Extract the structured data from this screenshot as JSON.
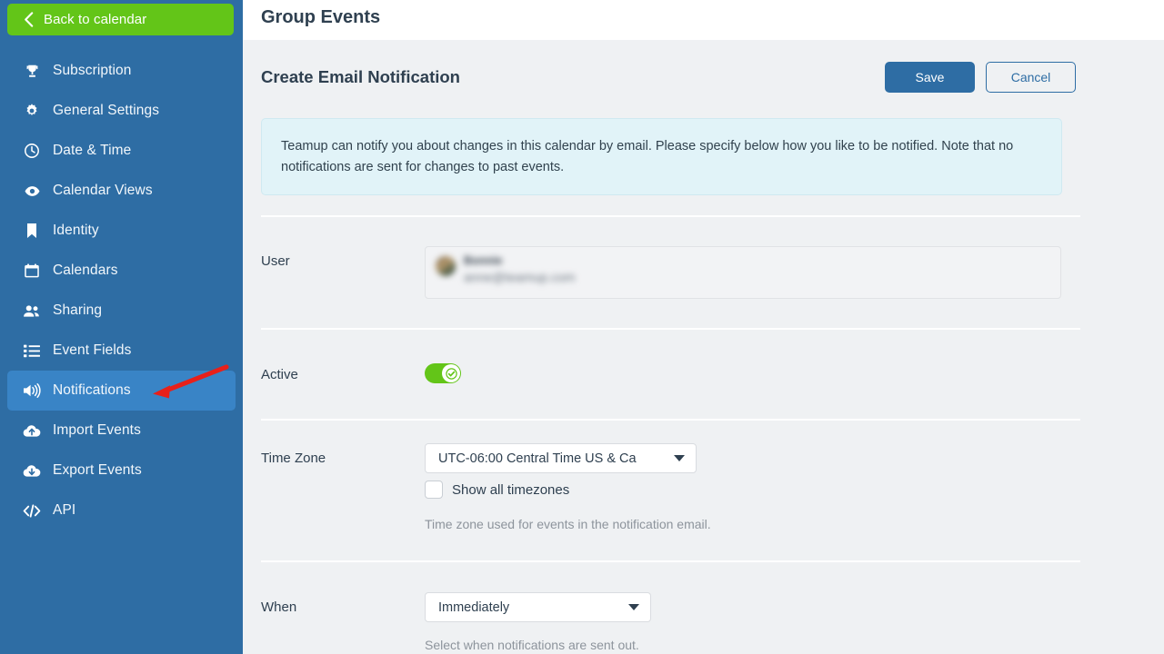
{
  "sidebar": {
    "back_button": {
      "label": "Back to calendar",
      "icon": "chevron-left-icon"
    },
    "items": [
      {
        "label": "Subscription",
        "icon": "trophy-icon",
        "active": false
      },
      {
        "label": "General Settings",
        "icon": "gear-icon",
        "active": false
      },
      {
        "label": "Date & Time",
        "icon": "clock-icon",
        "active": false
      },
      {
        "label": "Calendar Views",
        "icon": "eye-icon",
        "active": false
      },
      {
        "label": "Identity",
        "icon": "bookmark-icon",
        "active": false
      },
      {
        "label": "Calendars",
        "icon": "calendar-icon",
        "active": false
      },
      {
        "label": "Sharing",
        "icon": "users-icon",
        "active": false
      },
      {
        "label": "Event Fields",
        "icon": "list-icon",
        "active": false
      },
      {
        "label": "Notifications",
        "icon": "speaker-icon",
        "active": true
      },
      {
        "label": "Import Events",
        "icon": "cloud-upload-icon",
        "active": false
      },
      {
        "label": "Export Events",
        "icon": "cloud-download-icon",
        "active": false
      },
      {
        "label": "API",
        "icon": "code-icon",
        "active": false
      }
    ]
  },
  "topbar": {
    "title": "Group Events"
  },
  "page": {
    "title": "Create Email Notification",
    "save_label": "Save",
    "cancel_label": "Cancel"
  },
  "banner": {
    "text": "Teamup can notify you about changes in this calendar by email. Please specify below how you like to be notified. Note that no notifications are sent for changes to past events."
  },
  "form": {
    "user": {
      "label": "User",
      "name": "Bonnie",
      "email": "anne@teamup.com"
    },
    "active": {
      "label": "Active",
      "state_icon": "check-icon",
      "enabled": true
    },
    "timezone": {
      "label": "Time Zone",
      "value": "UTC-06:00 Central Time US & Ca",
      "caret_icon": "chevron-down-icon",
      "show_all_label": "Show all timezones",
      "show_all_checked": false,
      "help": "Time zone used for events in the notification email."
    },
    "when": {
      "label": "When",
      "value": "Immediately",
      "caret_icon": "chevron-down-icon",
      "help": "Select when notifications are sent out."
    }
  },
  "annotation": {
    "arrow_icon": "red-arrow-icon",
    "color": "#e8201a"
  },
  "colors": {
    "sidebar": "#2e6da4",
    "sidebar_active": "#3984c6",
    "green": "#63c518",
    "primary": "#2e6da4",
    "banner_bg": "#e1f3f8",
    "page_bg": "#eff1f3"
  }
}
